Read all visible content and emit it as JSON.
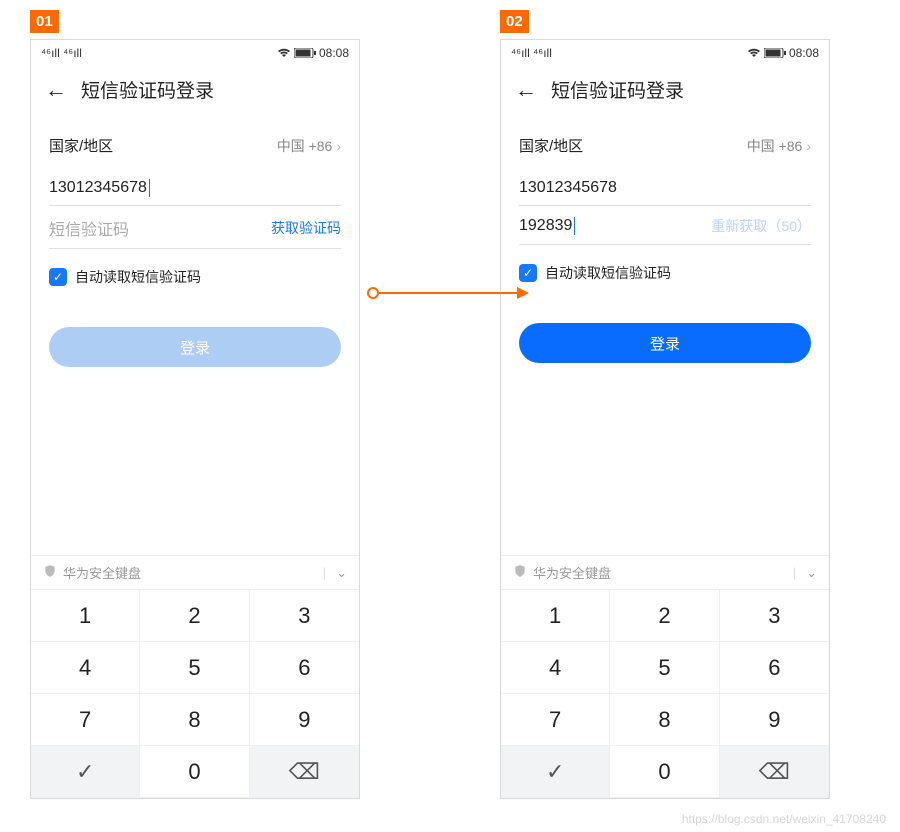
{
  "badges": {
    "left": "01",
    "right": "02"
  },
  "statusbar": {
    "signal_text": "⁴⁶ıll ⁴⁶ıll",
    "time": "08:08"
  },
  "header": {
    "title": "短信验证码登录"
  },
  "region": {
    "label": "国家/地区",
    "value": "中国 +86"
  },
  "screen1": {
    "phone": "13012345678",
    "sms_placeholder": "短信验证码",
    "get_code": "获取验证码",
    "login": "登录"
  },
  "screen2": {
    "phone": "13012345678",
    "sms_value": "192839",
    "resend": "重新获取（50）",
    "login": "登录"
  },
  "auto_read": "自动读取短信验证码",
  "keyboard": {
    "label": "华为安全键盘",
    "keys": [
      "1",
      "2",
      "3",
      "4",
      "5",
      "6",
      "7",
      "8",
      "9",
      "✓",
      "0",
      "⌫"
    ]
  },
  "watermark": "https://blog.csdn.net/weixin_41708240"
}
